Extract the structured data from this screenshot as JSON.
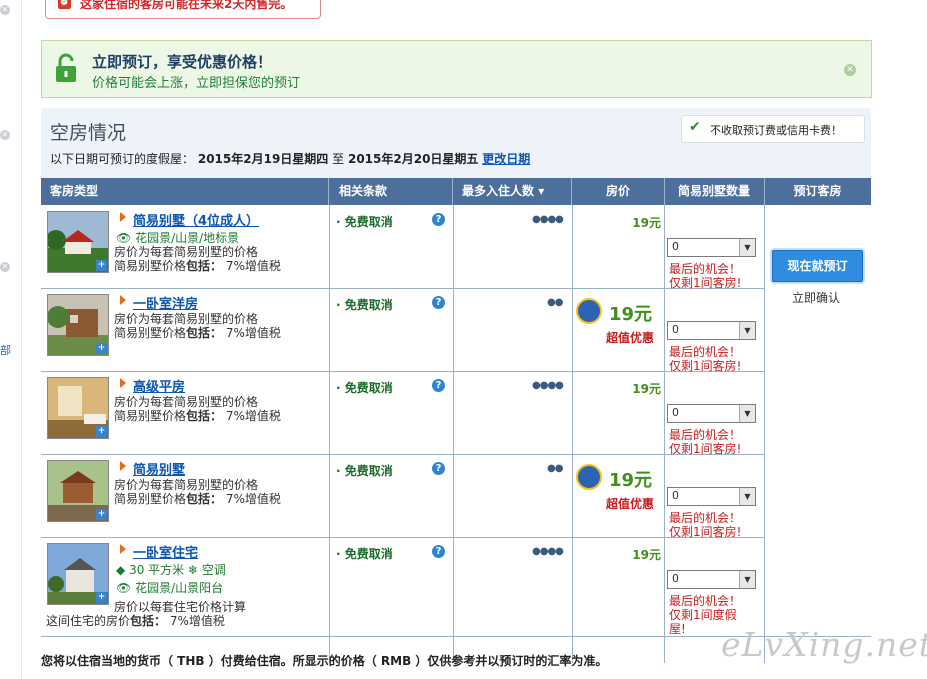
{
  "warning": {
    "text": "这家住宿的客房可能在未来2天内售完。"
  },
  "promo": {
    "title": "立即预订，享受优惠价格！",
    "subtitle": "价格可能会上涨，立即担保您的预订"
  },
  "availability": {
    "title": "空房情况",
    "no_fee_badge": "不收取预订费或信用卡费！",
    "dates_prefix": "以下日期可预订的度假屋：",
    "check_in": "2015年2月19日星期四",
    "dates_sep": "至",
    "check_out": "2015年2月20日星期五",
    "change_dates": "更改日期"
  },
  "table": {
    "headers": {
      "room_type": "客房类型",
      "conditions": "相关条款",
      "max_guests": "最多入住人数",
      "price": "房价",
      "quantity": "简易别墅数量",
      "reserve": "预订客房"
    },
    "rows": [
      {
        "name": "简易别墅（4位成人）",
        "feature": "花园景/山景/地标景",
        "desc1": "房价为每套简易别墅的价格",
        "desc2_prefix": "简易别墅价格",
        "desc2_bold": "包括：",
        "desc2_suffix": " 7%增值税",
        "condition": "免费取消",
        "occupancy": "●●●●",
        "price": "19元",
        "select": "0",
        "last1": "最后的机会！",
        "last2": "仅剩1间客房!"
      },
      {
        "name": "一卧室洋房",
        "desc1": "房价为每套简易别墅的价格",
        "desc2_prefix": "简易别墅价格",
        "desc2_bold": "包括：",
        "desc2_suffix": " 7%增值税",
        "condition": "免费取消",
        "occupancy": "●●",
        "price": "19元",
        "deal": "超值优惠",
        "select": "0",
        "last1": "最后的机会！",
        "last2": "仅剩1间客房!"
      },
      {
        "name": "高级平房",
        "desc1": "房价为每套简易别墅的价格",
        "desc2_prefix": "简易别墅价格",
        "desc2_bold": "包括：",
        "desc2_suffix": " 7%增值税",
        "condition": "免费取消",
        "occupancy": "●●●●",
        "price": "19元",
        "select": "0",
        "last1": "最后的机会！",
        "last2": "仅剩1间客房!"
      },
      {
        "name": "简易别墅",
        "desc1": "房价为每套简易别墅的价格",
        "desc2_prefix": "简易别墅价格",
        "desc2_bold": "包括：",
        "desc2_suffix": " 7%增值税",
        "condition": "免费取消",
        "occupancy": "●●",
        "price": "19元",
        "deal": "超值优惠",
        "select": "0",
        "last1": "最后的机会！",
        "last2": "仅剩1间客房!"
      },
      {
        "name": "一卧室住宅",
        "size": "30 平方米",
        "aircon": "空调",
        "feature": "花园景/山景阳台",
        "desc1": "房价以每套住宅价格计算",
        "desc2_prefix": "这间住宅的房价",
        "desc2_bold": "包括：",
        "desc2_suffix": " 7%增值税",
        "condition": "免费取消",
        "occupancy": "●●●●",
        "price": "19元",
        "select": "0",
        "last1": "最后的机会！",
        "last2": "仅剩1间度假",
        "last3": "屋!"
      }
    ],
    "book_button": "现在就预订",
    "instant_confirm": "立即确认"
  },
  "footer": "您将以住宿当地的货币（ THB ）付费给住宿。所显示的价格（ RMB ）仅供参考并以预订时的汇率为准。",
  "watermark": "eLvXing.net",
  "colors": {
    "header_bg": "#4c6f9c",
    "promo_bg": "#edf7e6",
    "price_green": "#3f8f1a",
    "alert_red": "#c82020",
    "link_blue": "#0b57b0",
    "button_blue": "#2f8de0"
  }
}
